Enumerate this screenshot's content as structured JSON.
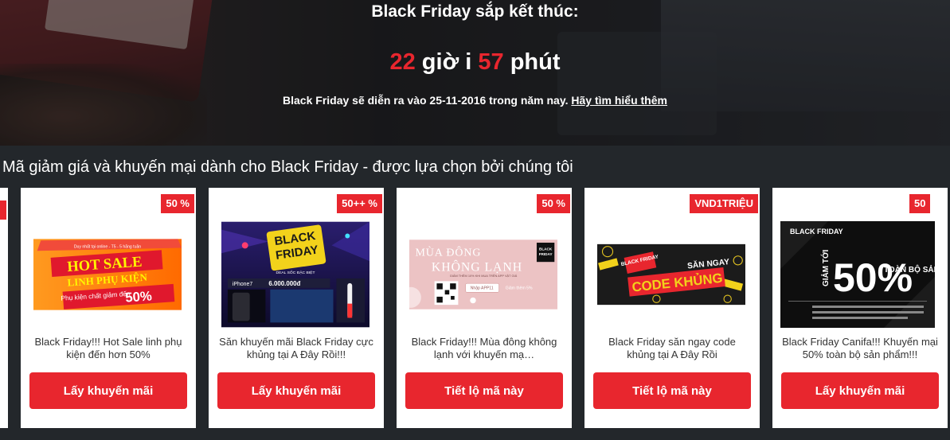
{
  "hero": {
    "title": "Black Friday sắp kết thúc:",
    "hours": "22",
    "hours_unit": "giờ i",
    "minutes": "57",
    "minutes_unit": "phút",
    "note": "Black Friday sẽ diễn ra vào 25-11-2016 trong năm nay.",
    "learn_more": "Hãy tìm hiểu thêm"
  },
  "section": {
    "title": "Mã giảm giá và khuyến mại dành cho Black Friday - được lựa chọn bởi chúng tôi"
  },
  "colors": {
    "accent": "#e8262e",
    "background": "#23272b"
  },
  "cards": [
    {
      "badge": "50 %",
      "description": "Black Friday!!! Hot Sale linh phụ kiện đến hơn 50%",
      "button": "Lấy khuyến mãi",
      "image": {
        "line1": "Duy nhất tại online - T5 - 5 hãng tuần",
        "line2": "HOT SALE",
        "line3": "LINH PHỤ KIỆN",
        "line4": "Phụ kiện chất giảm đến",
        "line5": "50%"
      }
    },
    {
      "badge": "50++ %",
      "description": "Săn khuyến mãi Black Friday cực khủng tại A Đây Rồi!!!",
      "button": "Lấy khuyến mãi",
      "image": {
        "line1": "BLACK",
        "line2": "FRIDAY",
        "line3": "DEAL SỐC ĐẶC BIỆT",
        "line4": "iPhone7",
        "line5": "6.000.000đ"
      }
    },
    {
      "badge": "50 %",
      "description": "Black Friday!!! Mùa đông không lạnh với khuyến mạ…",
      "button": "Tiết lộ mã này",
      "image": {
        "line1": "MÙA ĐÔNG",
        "line2": "KHÔNG LẠNH",
        "line3": "GIẢM THÊM 10% KHI MUA TRÊN APP VẬT GIÁ",
        "line4": "Nhập APP11",
        "line5": "Giảm thêm 5%"
      }
    },
    {
      "badge": "VND1TRIỆU",
      "description": "Black Friday săn ngay code khủng tại A Đây Rồi",
      "button": "Tiết lộ mã này",
      "image": {
        "line1": "BLACK FRIDAY",
        "line2": "SĂN NGAY",
        "line3": "CODE KHỦNG"
      }
    },
    {
      "badge": "50",
      "description": "Black Friday Canifa!!! Khuyến mại 50% toàn bộ sản phẩm!!!",
      "button": "Lấy khuyến mãi",
      "image": {
        "line1": "BLACK FRIDAY",
        "line2": "GIẢM TỚI",
        "line3": "50%",
        "line4": "TOÀN BỘ SẢN PHẨM"
      }
    }
  ]
}
